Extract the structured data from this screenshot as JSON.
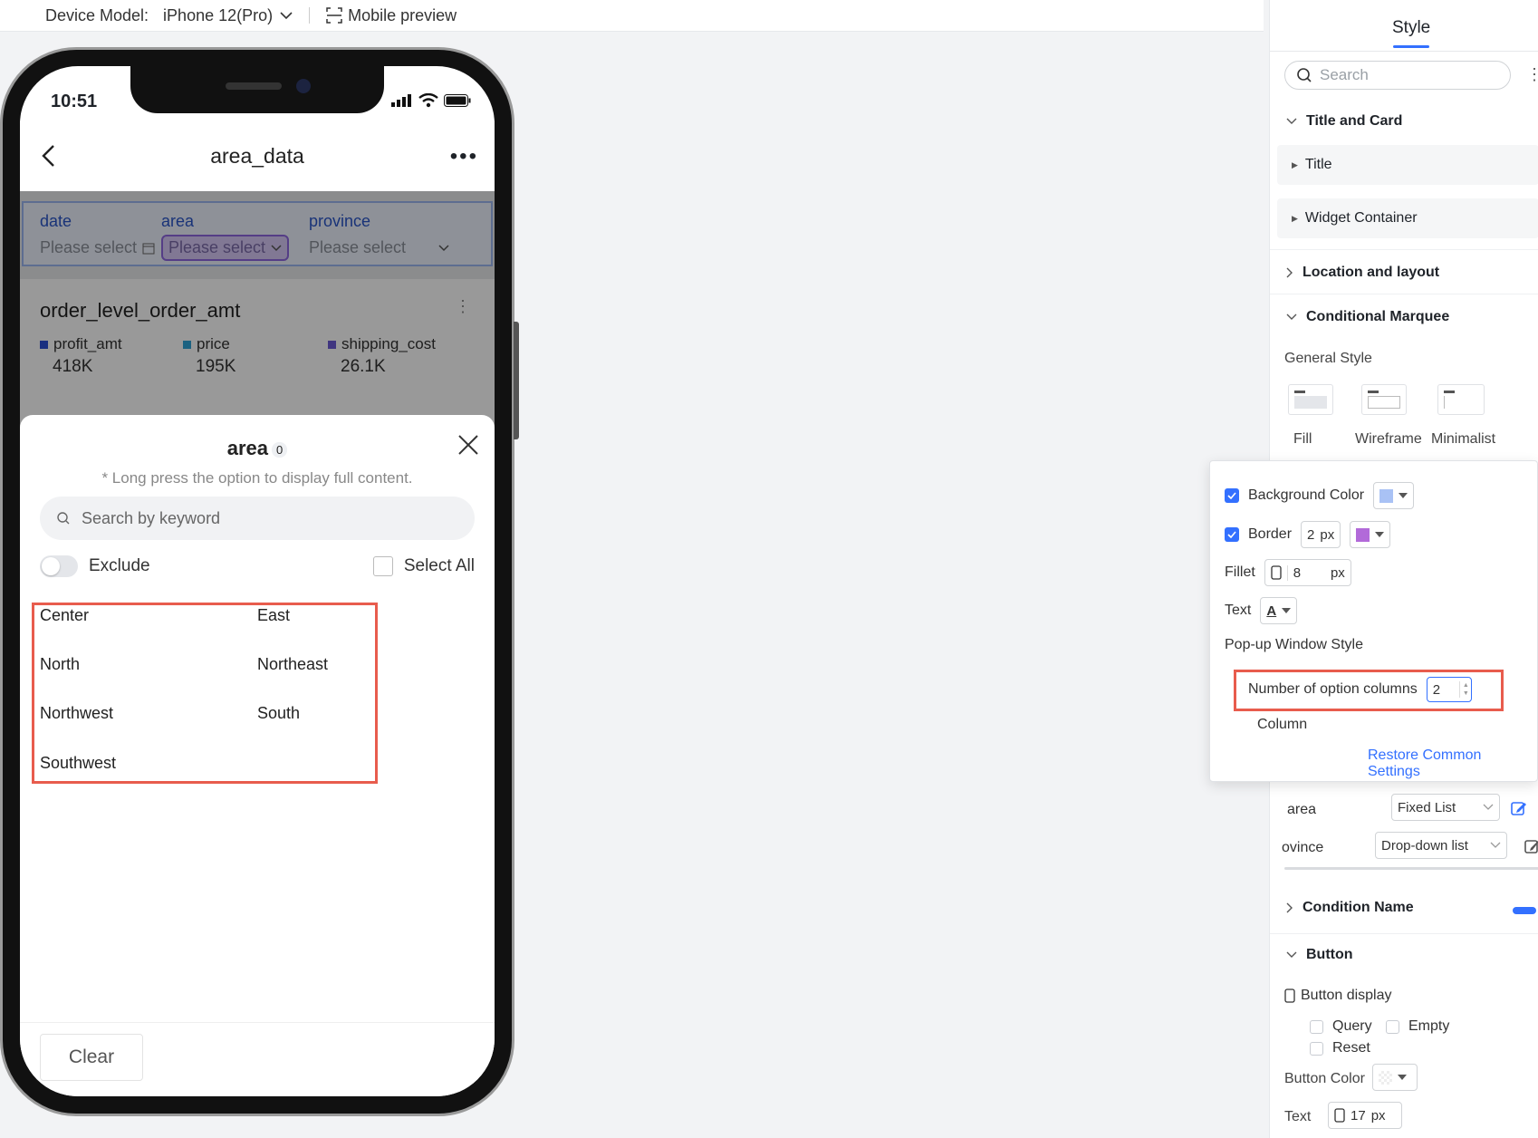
{
  "topbar": {
    "device_label": "Device Model:",
    "device_value": "iPhone 12(Pro)",
    "preview_label": "Mobile preview"
  },
  "phone": {
    "time": "10:51",
    "nav_title": "area_data",
    "filters": [
      {
        "label": "date",
        "placeholder": "Please select"
      },
      {
        "label": "area",
        "placeholder": "Please select"
      },
      {
        "label": "province",
        "placeholder": "Please select"
      }
    ],
    "card": {
      "title": "order_level_order_amt",
      "legend": [
        {
          "name": "profit_amt",
          "value": "418K",
          "color": "#2a4fd6"
        },
        {
          "name": "price",
          "value": "195K",
          "color": "#2fa3d8"
        },
        {
          "name": "shipping_cost",
          "value": "26.1K",
          "color": "#6c5bd6"
        }
      ]
    },
    "sheet": {
      "title": "area",
      "count": "0",
      "hint": "* Long press the option to display full content.",
      "search_placeholder": "Search by keyword",
      "exclude_label": "Exclude",
      "select_all_label": "Select All",
      "options": [
        "Center",
        "East",
        "North",
        "Northeast",
        "Northwest",
        "South",
        "Southwest"
      ],
      "clear_label": "Clear"
    }
  },
  "panel": {
    "tab": "Style",
    "search_placeholder": "Search",
    "sections": {
      "title_card": "Title and Card",
      "title": "Title",
      "widget_container": "Widget Container",
      "location_layout": "Location and layout",
      "conditional_marquee": "Conditional Marquee",
      "general_style": "General Style",
      "style_options": [
        "Fill",
        "Wireframe",
        "Minimalist"
      ],
      "condition_name": "Condition Name",
      "button": "Button",
      "button_display": "Button display",
      "query": "Query",
      "empty": "Empty",
      "reset": "Reset",
      "button_color": "Button Color",
      "text": "Text",
      "text_size": "17",
      "px": "px"
    },
    "fields": [
      {
        "name": "area",
        "type": "Fixed List"
      },
      {
        "name": "ovince",
        "type": "Drop-down list"
      }
    ]
  },
  "popover": {
    "background_color": "Background Color",
    "border": "Border",
    "border_value": "2",
    "fillet": "Fillet",
    "fillet_value": "8",
    "px": "px",
    "text": "Text",
    "text_glyph": "A",
    "popup_style": "Pop-up Window Style",
    "num_columns_label": "Number of option columns",
    "num_columns_value": "2",
    "column": "Column",
    "restore": "Restore Common Settings",
    "colors": {
      "background": "#a9c2f5",
      "border": "#b26ad9"
    }
  }
}
